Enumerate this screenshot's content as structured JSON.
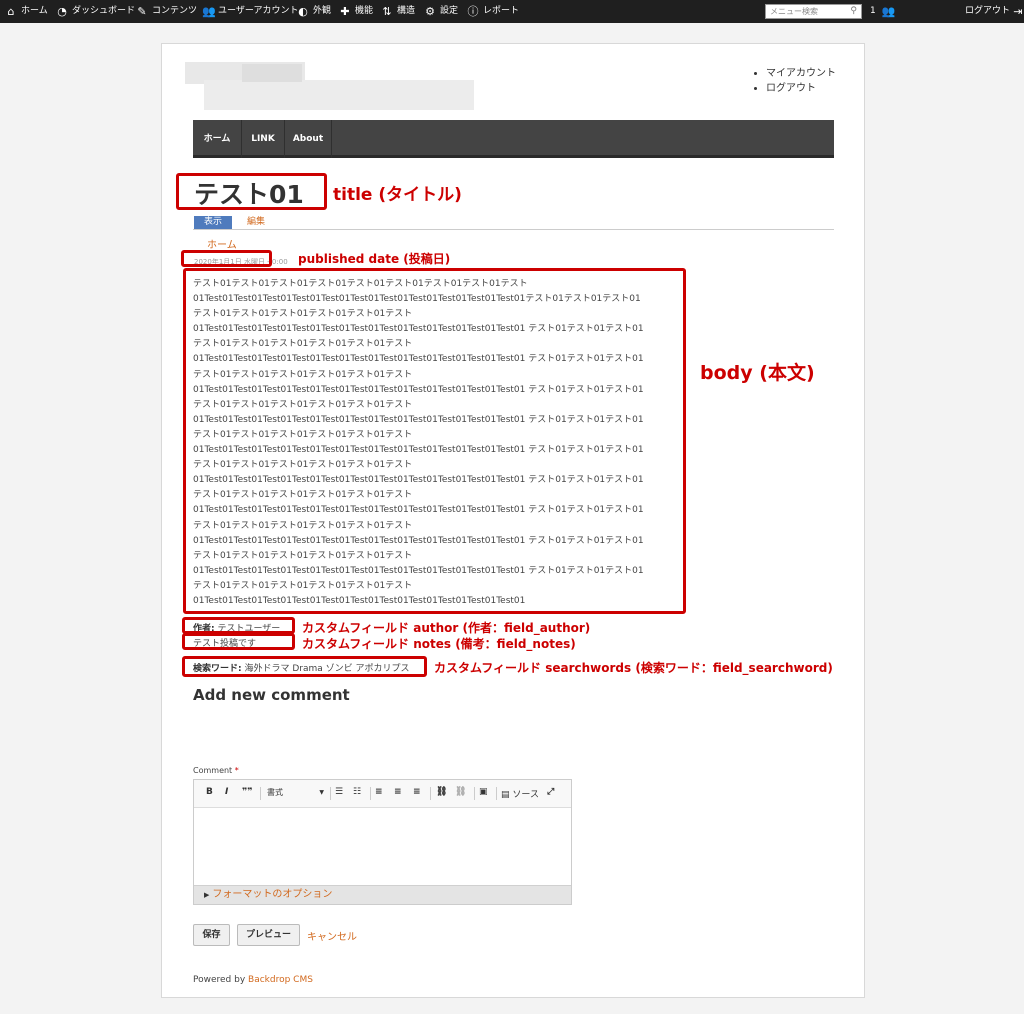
{
  "admin_bar": {
    "items": [
      {
        "label": "ホーム",
        "icon": "home-icon"
      },
      {
        "label": "ダッシュボード",
        "icon": "dashboard-icon"
      },
      {
        "label": "コンテンツ",
        "icon": "pencil-icon"
      },
      {
        "label": "ユーザーアカウント",
        "icon": "users-icon"
      },
      {
        "label": "外観",
        "icon": "palette-icon"
      },
      {
        "label": "機能",
        "icon": "puzzle-icon"
      },
      {
        "label": "構造",
        "icon": "structure-icon"
      },
      {
        "label": "設定",
        "icon": "gear-icon"
      },
      {
        "label": "レポート",
        "icon": "info-icon"
      }
    ],
    "search_placeholder": "メニュー検索",
    "user_count": "1",
    "logout_label": "ログアウト"
  },
  "user_menu": {
    "items": [
      "マイアカウント",
      "ログアウト"
    ]
  },
  "nav": {
    "tabs": [
      "ホーム",
      "LINK",
      "About"
    ]
  },
  "node": {
    "title": "テスト01",
    "tab_view": "表示",
    "tab_edit": "編集",
    "breadcrumb": "ホーム",
    "date": "2020年1月1日 水曜日 - 0:00",
    "body_lines": [
      "テスト01テスト01テスト01テスト01テスト01テスト01テスト01テスト01テスト",
      "01Test01Test01Test01Test01Test01Test01Test01Test01Test01Test01Test01テスト01テスト01テスト01",
      "テスト01テスト01テスト01テスト01テスト01テスト",
      "01Test01Test01Test01Test01Test01Test01Test01Test01Test01Test01Test01 テスト01テスト01テスト01",
      "テスト01テスト01テスト01テスト01テスト01テスト",
      "01Test01Test01Test01Test01Test01Test01Test01Test01Test01Test01Test01 テスト01テスト01テスト01",
      "テスト01テスト01テスト01テスト01テスト01テスト",
      "01Test01Test01Test01Test01Test01Test01Test01Test01Test01Test01Test01 テスト01テスト01テスト01",
      "テスト01テスト01テスト01テスト01テスト01テスト",
      "01Test01Test01Test01Test01Test01Test01Test01Test01Test01Test01Test01 テスト01テスト01テスト01",
      "テスト01テスト01テスト01テスト01テスト01テスト",
      "01Test01Test01Test01Test01Test01Test01Test01Test01Test01Test01Test01 テスト01テスト01テスト01",
      "テスト01テスト01テスト01テスト01テスト01テスト",
      "01Test01Test01Test01Test01Test01Test01Test01Test01Test01Test01Test01 テスト01テスト01テスト01",
      "テスト01テスト01テスト01テスト01テスト01テスト",
      "01Test01Test01Test01Test01Test01Test01Test01Test01Test01Test01Test01 テスト01テスト01テスト01",
      "テスト01テスト01テスト01テスト01テスト01テスト",
      "01Test01Test01Test01Test01Test01Test01Test01Test01Test01Test01Test01 テスト01テスト01テスト01",
      "テスト01テスト01テスト01テスト01テスト01テスト",
      "01Test01Test01Test01Test01Test01Test01Test01Test01Test01Test01Test01 テスト01テスト01テスト01",
      "テスト01テスト01テスト01テスト01テスト01テスト",
      "01Test01Test01Test01Test01Test01Test01Test01Test01Test01Test01Test01"
    ],
    "author_label": "作者:",
    "author_value": "テストユーザー",
    "notes_value": "テスト投稿です",
    "searchwords_label": "検索ワード:",
    "searchwords_value": "海外ドラマ Drama ゾンビ アポカリプス"
  },
  "annotations": {
    "title": "title (タイトル)",
    "date": "published date (投稿日)",
    "body": "body (本文)",
    "author": "カスタムフィールド author (作者：field_author)",
    "notes": "カスタムフィールド notes (備考：field_notes)",
    "searchwords": "カスタムフィールド searchwords (検索ワード：field_searchword)",
    "color": "#cc0000"
  },
  "comment": {
    "heading": "Add new comment",
    "label": "Comment",
    "required_mark": "*",
    "format_select": "書式",
    "source_label": "ソース",
    "format_options": "フォーマットのオプション",
    "save": "保存",
    "preview": "プレビュー",
    "cancel": "キャンセル"
  },
  "footer": {
    "powered_prefix": "Powered by ",
    "powered_link": "Backdrop CMS"
  }
}
